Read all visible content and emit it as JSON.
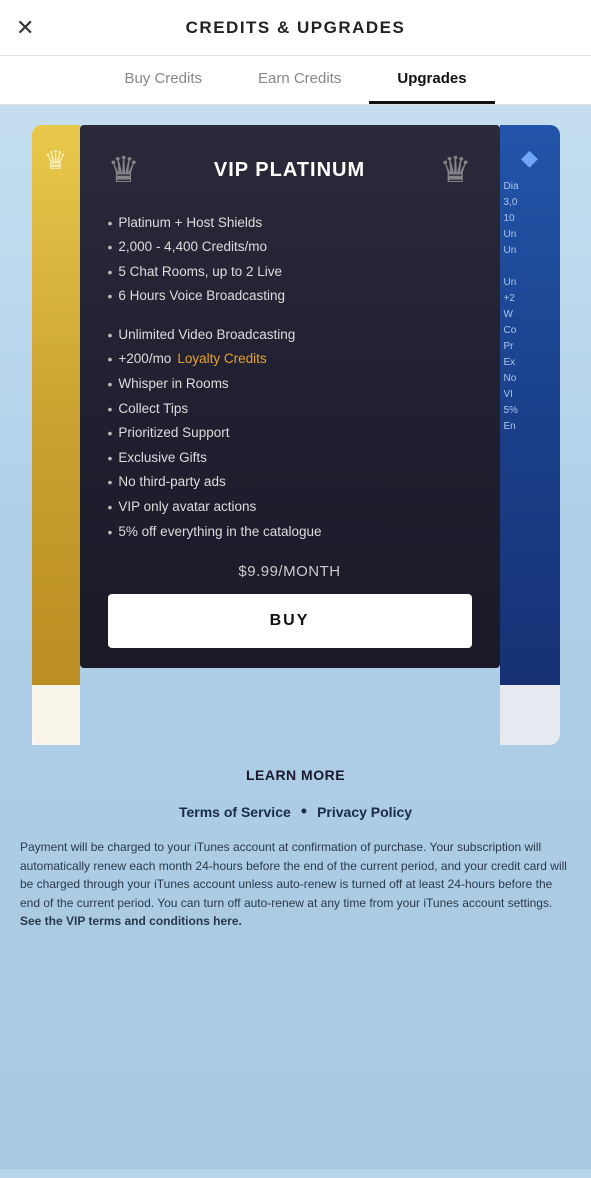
{
  "header": {
    "title": "CREDITS & UPGRADES",
    "close_label": "✕"
  },
  "tabs": [
    {
      "id": "buy",
      "label": "Buy Credits",
      "active": false
    },
    {
      "id": "earn",
      "label": "Earn Credits",
      "active": false
    },
    {
      "id": "upgrades",
      "label": "Upgrades",
      "active": true
    }
  ],
  "vip_platinum": {
    "title": "VIP PLATINUM",
    "crown_left": "♛",
    "crown_right": "♛",
    "features_group1": [
      "Platinum + Host Shields",
      "2,000 - 4,400 Credits/mo",
      "5 Chat Rooms, up to 2 Live",
      "6 Hours Voice Broadcasting"
    ],
    "features_group2": [
      "Unlimited Video Broadcasting",
      "+200/mo Loyalty Credits",
      "Whisper in Rooms",
      "Collect Tips",
      "Prioritized Support",
      "Exclusive Gifts",
      "No third-party ads",
      "VIP only avatar actions",
      "5% off everything in the catalogue"
    ],
    "loyalty_credits_label": "Loyalty Credits",
    "price": "$9.99/MONTH",
    "buy_label": "BUY"
  },
  "side_right_partial": [
    "Dia",
    "3,0",
    "10",
    "Un",
    "Un",
    "",
    "Un",
    "+2",
    "W",
    "Co",
    "Pr",
    "Ex",
    "No",
    "VI",
    "5%",
    "En"
  ],
  "learn_more": "LEARN MORE",
  "footer": {
    "terms": "Terms of Service",
    "privacy": "Privacy Policy",
    "dot": "•",
    "disclaimer": "Payment will be charged to your iTunes account at confirmation of purchase. Your subscription will automatically renew each month 24-hours before the end of the current period, and your credit card will be charged through your iTunes account unless auto-renew is turned off at least 24-hours before the end of the current period. You can turn off auto-renew at any time from your iTunes account settings.",
    "vip_terms": "See the VIP terms and conditions here."
  }
}
